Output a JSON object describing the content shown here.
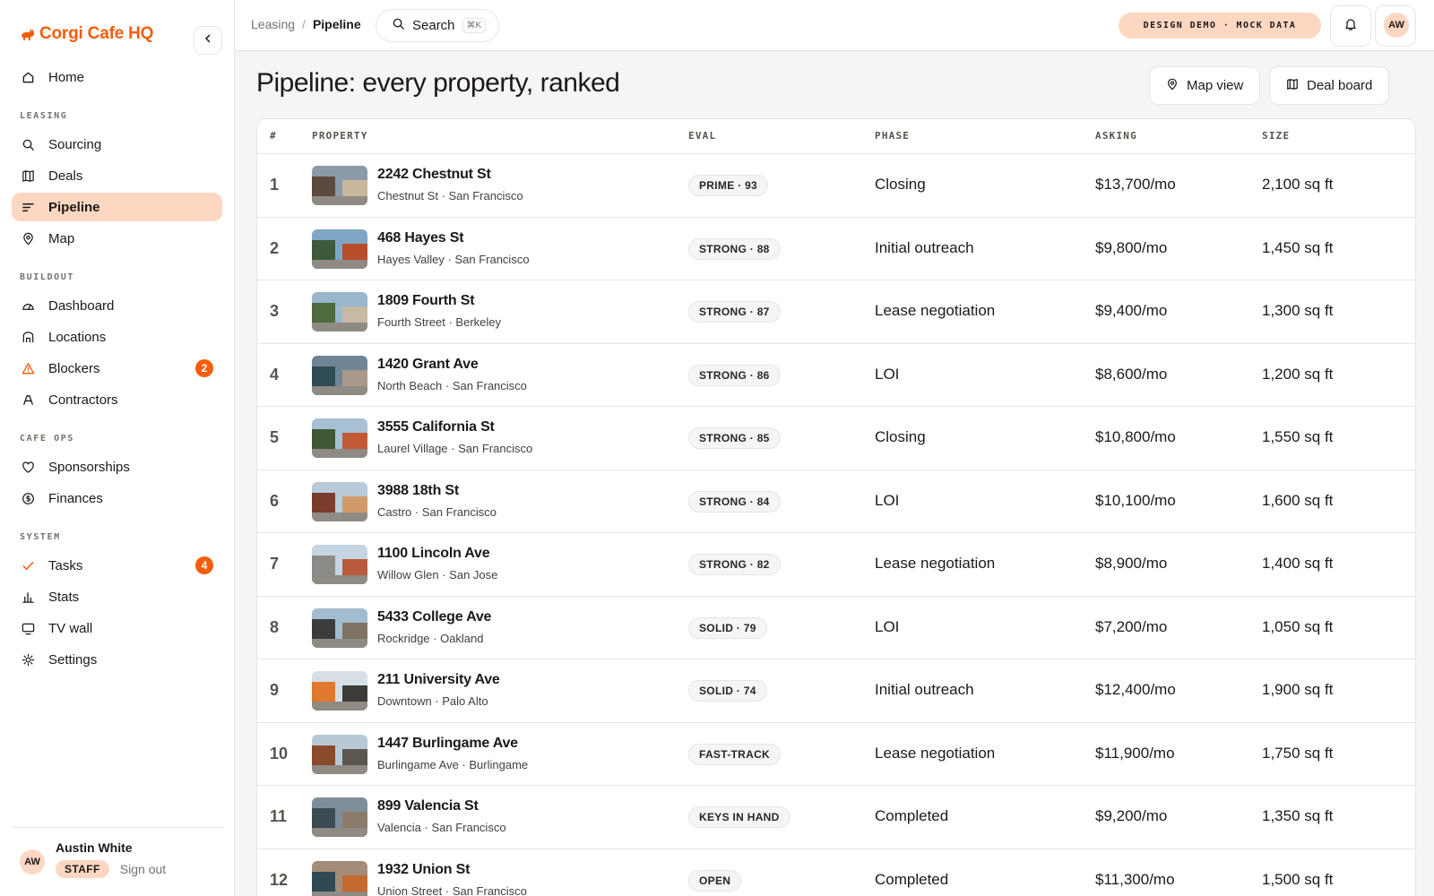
{
  "app": {
    "brand_name": "Corgi Cafe HQ",
    "accent_color": "#f45d0a",
    "accent_soft": "#fed7c3"
  },
  "sidebar": {
    "collapse_icon": "chevron-left-icon",
    "home": {
      "label": "Home",
      "icon": "home-icon"
    },
    "sections": [
      {
        "label": "LEASING"
      },
      {
        "label": "BUILDOUT"
      },
      {
        "label": "CAFE OPS"
      },
      {
        "label": "SYSTEM"
      }
    ],
    "leasing": [
      {
        "label": "Sourcing",
        "icon": "search-icon"
      },
      {
        "label": "Deals",
        "icon": "board-icon"
      },
      {
        "label": "Pipeline",
        "icon": "list-icon",
        "active": true
      },
      {
        "label": "Map",
        "icon": "map-pin-icon"
      }
    ],
    "buildout": [
      {
        "label": "Dashboard",
        "icon": "gauge-icon"
      },
      {
        "label": "Locations",
        "icon": "storefront-icon"
      },
      {
        "label": "Blockers",
        "icon": "warning-icon",
        "badge": "2"
      },
      {
        "label": "Contractors",
        "icon": "hardhat-icon"
      }
    ],
    "cafe_ops": [
      {
        "label": "Sponsorships",
        "icon": "heart-icon"
      },
      {
        "label": "Finances",
        "icon": "dollar-icon"
      }
    ],
    "system": [
      {
        "label": "Tasks",
        "icon": "check-icon",
        "badge": "4"
      },
      {
        "label": "Stats",
        "icon": "bar-chart-icon"
      },
      {
        "label": "TV wall",
        "icon": "monitor-icon"
      },
      {
        "label": "Settings",
        "icon": "gear-icon"
      }
    ],
    "user": {
      "initials": "AW",
      "name": "Austin White",
      "role": "STAFF",
      "signout": "Sign out"
    }
  },
  "topbar": {
    "breadcrumb": [
      "Leasing",
      "Pipeline"
    ],
    "breadcrumb_sep": "/",
    "search_label": "Search",
    "search_shortcut": "⌘K",
    "demo_badge": "DESIGN DEMO · MOCK DATA",
    "avatar_initials": "AW"
  },
  "page": {
    "title": "Pipeline: every property, ranked",
    "map_view_label": "Map view",
    "deal_board_label": "Deal board"
  },
  "table": {
    "columns": [
      "#",
      "PROPERTY",
      "EVAL",
      "PHASE",
      "ASKING",
      "SIZE"
    ],
    "rows": [
      {
        "rank": "1",
        "name": "2242 Chestnut St",
        "location": "Chestnut St · San Francisco",
        "eval": "PRIME · 93",
        "phase": "Closing",
        "asking": "$13,700/mo",
        "size": "2,100 sq ft"
      },
      {
        "rank": "2",
        "name": "468 Hayes St",
        "location": "Hayes Valley · San Francisco",
        "eval": "STRONG · 88",
        "phase": "Initial outreach",
        "asking": "$9,800/mo",
        "size": "1,450 sq ft"
      },
      {
        "rank": "3",
        "name": "1809 Fourth St",
        "location": "Fourth Street · Berkeley",
        "eval": "STRONG · 87",
        "phase": "Lease negotiation",
        "asking": "$9,400/mo",
        "size": "1,300 sq ft"
      },
      {
        "rank": "4",
        "name": "1420 Grant Ave",
        "location": "North Beach · San Francisco",
        "eval": "STRONG · 86",
        "phase": "LOI",
        "asking": "$8,600/mo",
        "size": "1,200 sq ft"
      },
      {
        "rank": "5",
        "name": "3555 California St",
        "location": "Laurel Village · San Francisco",
        "eval": "STRONG · 85",
        "phase": "Closing",
        "asking": "$10,800/mo",
        "size": "1,550 sq ft"
      },
      {
        "rank": "6",
        "name": "3988 18th St",
        "location": "Castro · San Francisco",
        "eval": "STRONG · 84",
        "phase": "LOI",
        "asking": "$10,100/mo",
        "size": "1,600 sq ft"
      },
      {
        "rank": "7",
        "name": "1100 Lincoln Ave",
        "location": "Willow Glen · San Jose",
        "eval": "STRONG · 82",
        "phase": "Lease negotiation",
        "asking": "$8,900/mo",
        "size": "1,400 sq ft"
      },
      {
        "rank": "8",
        "name": "5433 College Ave",
        "location": "Rockridge · Oakland",
        "eval": "SOLID · 79",
        "phase": "LOI",
        "asking": "$7,200/mo",
        "size": "1,050 sq ft"
      },
      {
        "rank": "9",
        "name": "211 University Ave",
        "location": "Downtown · Palo Alto",
        "eval": "SOLID · 74",
        "phase": "Initial outreach",
        "asking": "$12,400/mo",
        "size": "1,900 sq ft"
      },
      {
        "rank": "10",
        "name": "1447 Burlingame Ave",
        "location": "Burlingame Ave · Burlingame",
        "eval": "FAST-TRACK",
        "phase": "Lease negotiation",
        "asking": "$11,900/mo",
        "size": "1,750 sq ft"
      },
      {
        "rank": "11",
        "name": "899 Valencia St",
        "location": "Valencia · San Francisco",
        "eval": "KEYS IN HAND",
        "phase": "Completed",
        "asking": "$9,200/mo",
        "size": "1,350 sq ft"
      },
      {
        "rank": "12",
        "name": "1932 Union St",
        "location": "Union Street · San Francisco",
        "eval": "OPEN",
        "phase": "Completed",
        "asking": "$11,300/mo",
        "size": "1,500 sq ft"
      }
    ]
  }
}
